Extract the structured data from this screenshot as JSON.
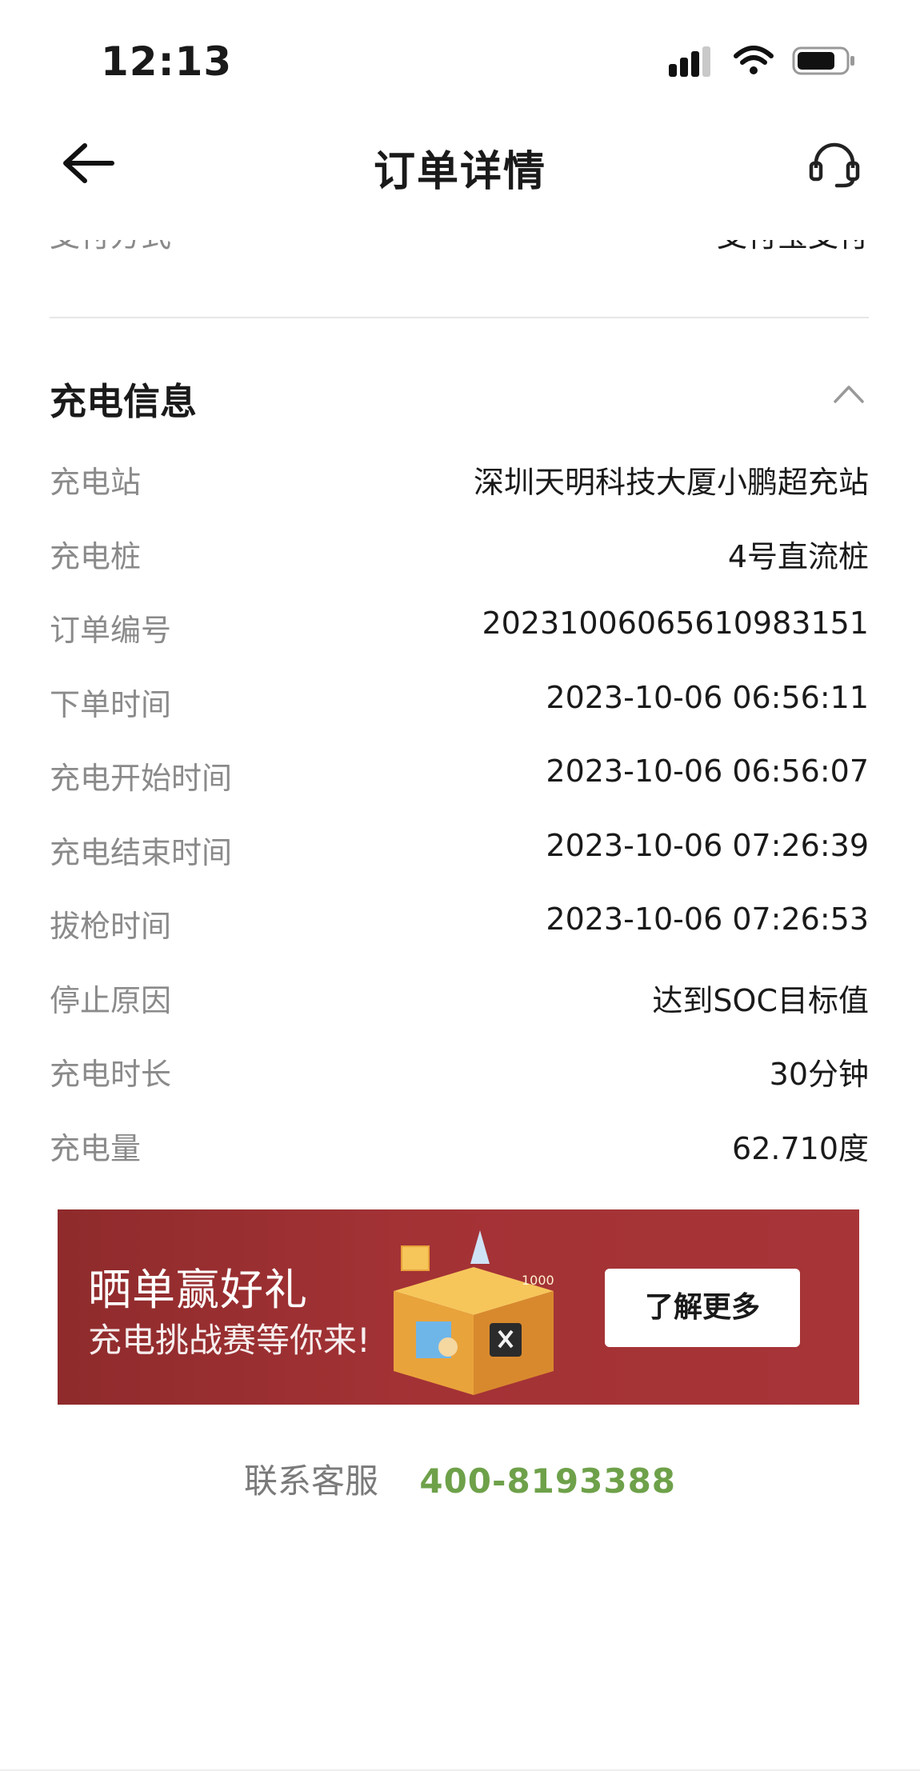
{
  "status_bar": {
    "time": "12:13"
  },
  "nav": {
    "title": "订单详情"
  },
  "partial_row": {
    "label": "支付方式",
    "value": "支付宝支付"
  },
  "section": {
    "title": "充电信息"
  },
  "info_rows": [
    {
      "label": "充电站",
      "value": "深圳天明科技大厦小鹏超充站"
    },
    {
      "label": "充电桩",
      "value": "4号直流桩"
    },
    {
      "label": "订单编号",
      "value": "20231006065610983151"
    },
    {
      "label": "下单时间",
      "value": "2023-10-06 06:56:11"
    },
    {
      "label": "充电开始时间",
      "value": "2023-10-06 06:56:07"
    },
    {
      "label": "充电结束时间",
      "value": "2023-10-06 07:26:39"
    },
    {
      "label": "拔枪时间",
      "value": "2023-10-06 07:26:53"
    },
    {
      "label": "停止原因",
      "value": "达到SOC目标值"
    },
    {
      "label": "充电时长",
      "value": "30分钟"
    },
    {
      "label": "充电量",
      "value": "62.710度"
    }
  ],
  "banner": {
    "title": "晒单赢好礼",
    "subtitle": "充电挑战赛等你来!",
    "button": "了解更多",
    "colors": {
      "background": "#a33235",
      "button": "#ffffff"
    }
  },
  "contact": {
    "label": "联系客服",
    "phone": "400-8193388",
    "phone_color": "#6ea14a"
  }
}
